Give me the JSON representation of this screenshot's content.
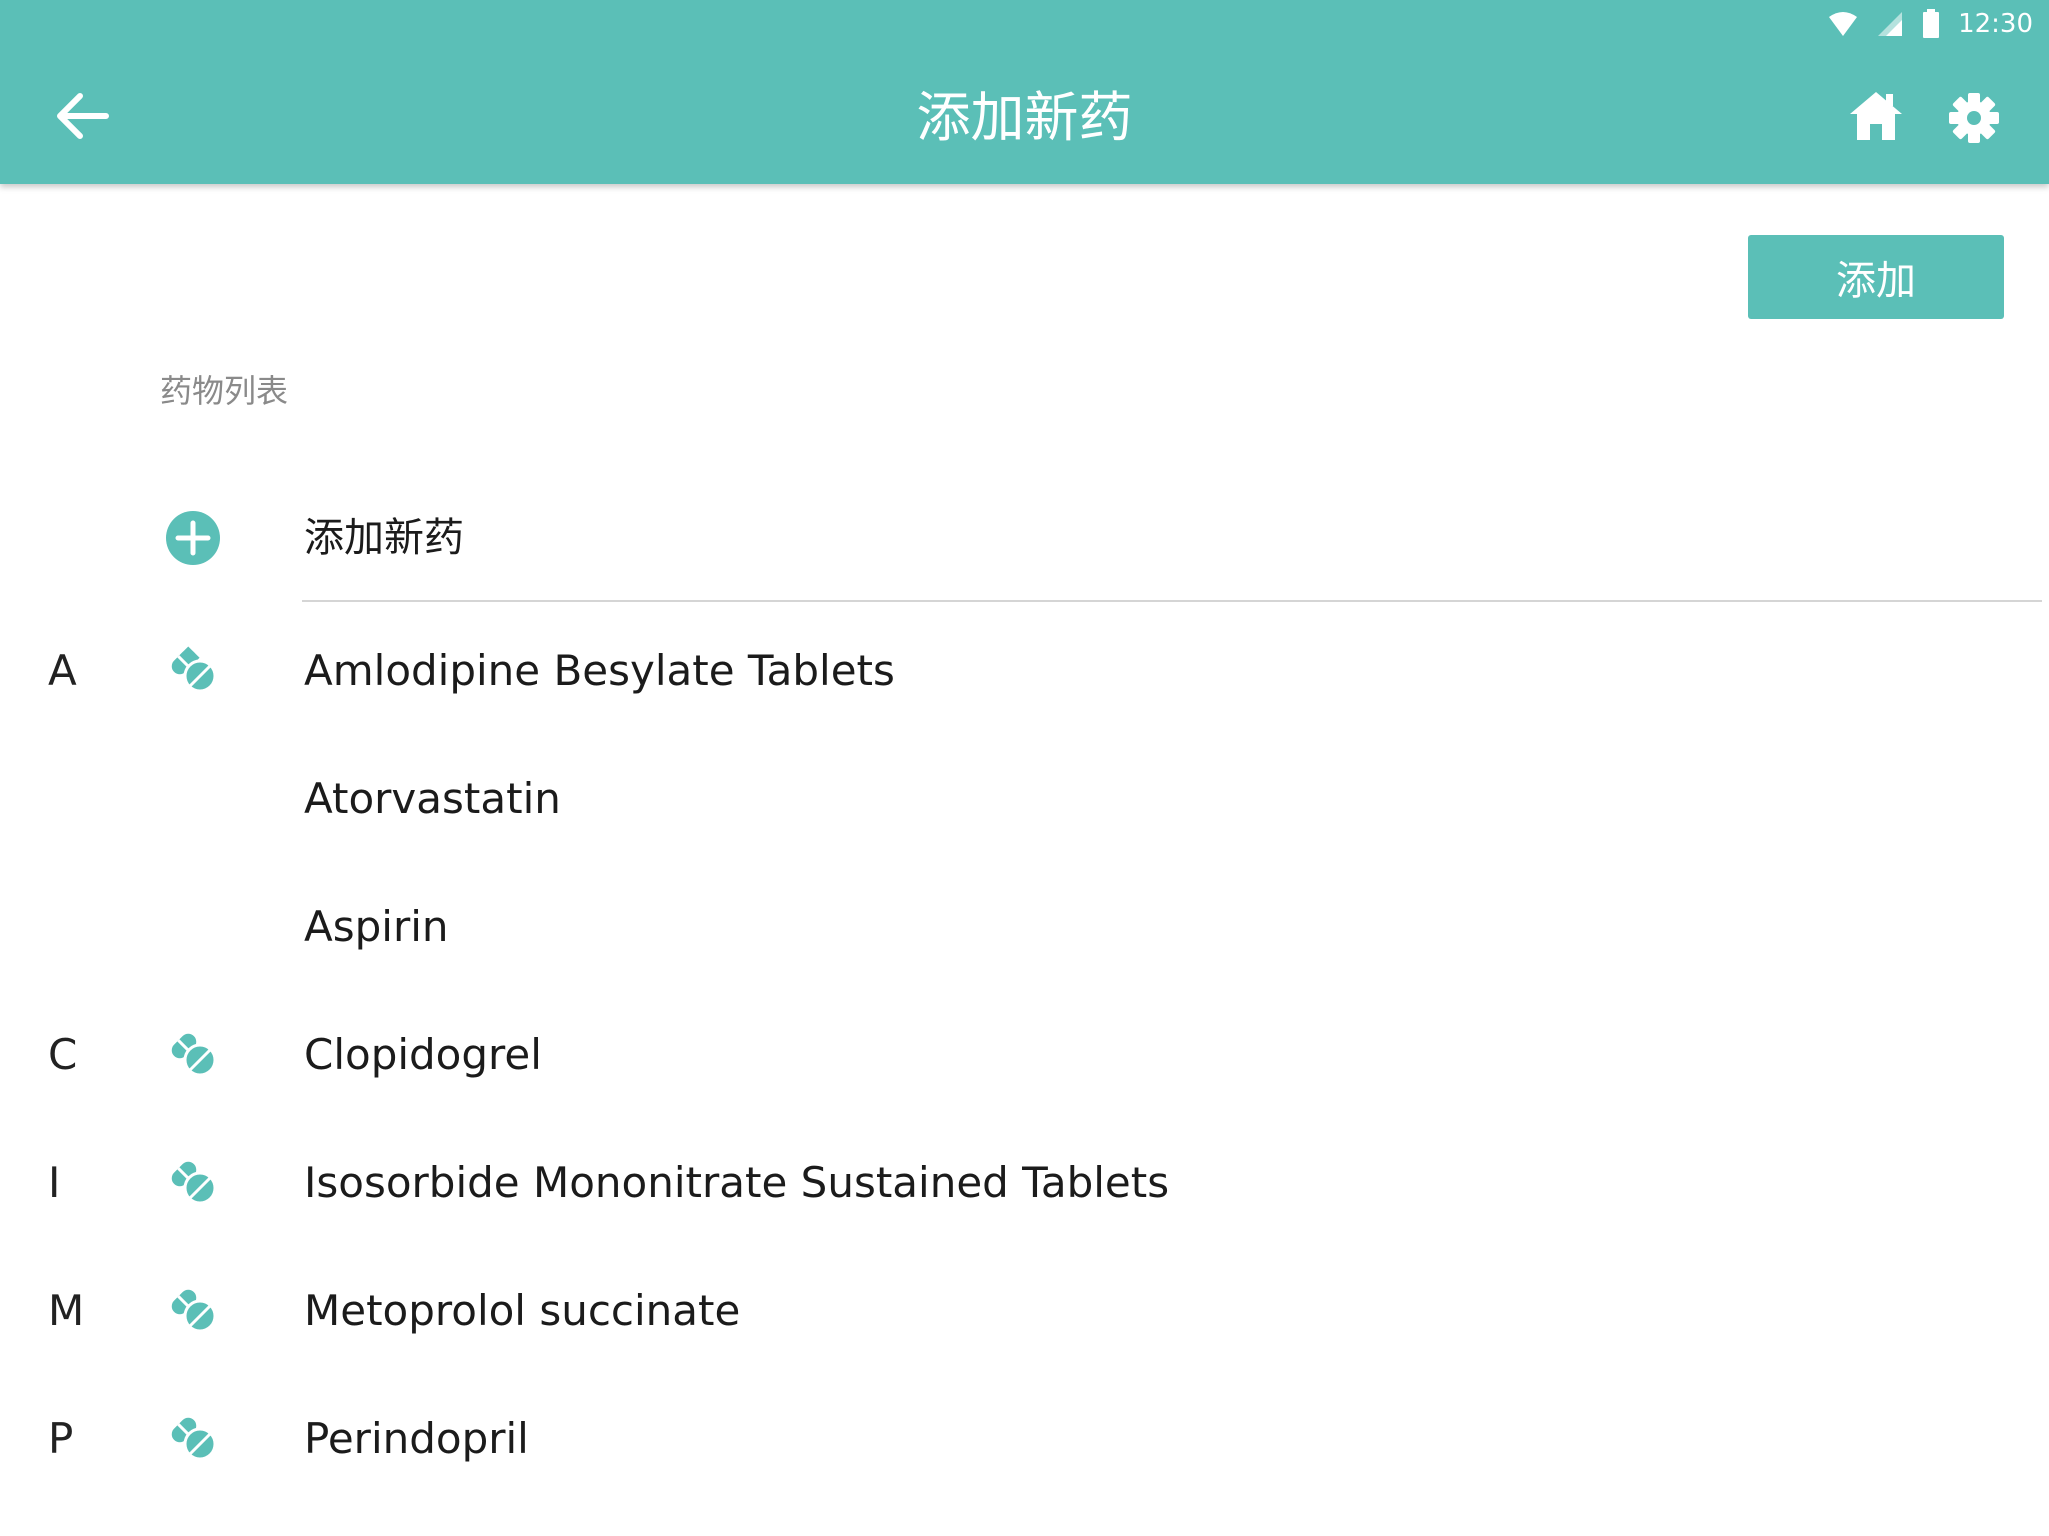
{
  "status": {
    "time": "12:30"
  },
  "appbar": {
    "title": "添加新药"
  },
  "toolbar": {
    "add_button": "添加"
  },
  "section": {
    "label": "药物列表"
  },
  "add_row": {
    "label": "添加新药"
  },
  "medications": [
    {
      "letter": "A",
      "name": "Amlodipine Besylate Tablets",
      "show_icon": true
    },
    {
      "letter": "",
      "name": "Atorvastatin",
      "show_icon": false
    },
    {
      "letter": "",
      "name": "Aspirin",
      "show_icon": false
    },
    {
      "letter": "C",
      "name": "Clopidogrel",
      "show_icon": true
    },
    {
      "letter": "I",
      "name": "Isosorbide Mononitrate Sustained Tablets",
      "show_icon": true
    },
    {
      "letter": "M",
      "name": "Metoprolol succinate",
      "show_icon": true
    },
    {
      "letter": "P",
      "name": "Perindopril",
      "show_icon": true
    }
  ],
  "colors": {
    "accent": "#5bbfb7",
    "divider": "#d5d5d5",
    "muted_text": "#8a8a8a"
  },
  "icons": [
    "wifi-icon",
    "signal-icon",
    "battery-icon",
    "back-arrow-icon",
    "home-icon",
    "gear-icon",
    "plus-circle-icon",
    "pill-icon"
  ]
}
